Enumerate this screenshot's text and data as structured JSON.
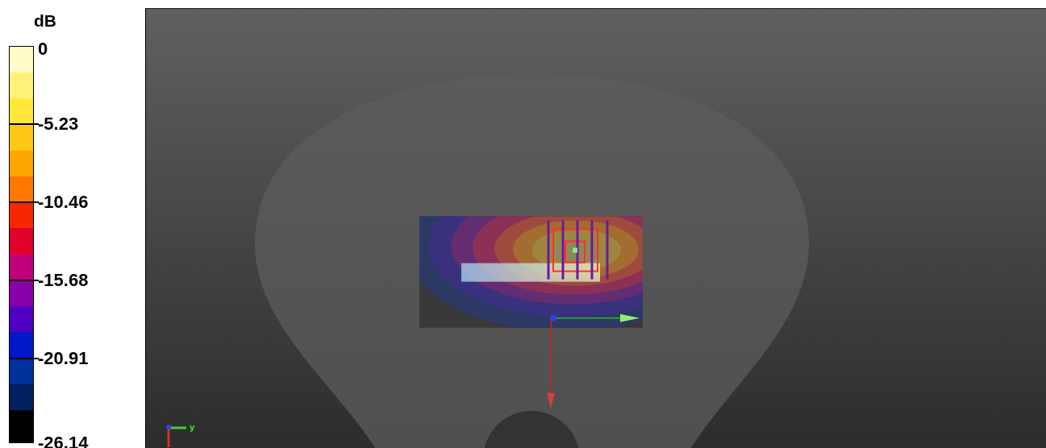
{
  "colorbar": {
    "unit": "dB",
    "swatches": [
      {
        "color": "#fffcc8"
      },
      {
        "color": "#fff27a"
      },
      {
        "color": "#ffe83a"
      },
      {
        "color": "#ffc815"
      },
      {
        "color": "#ffa500"
      },
      {
        "color": "#ff7800"
      },
      {
        "color": "#f52800"
      },
      {
        "color": "#e0002a"
      },
      {
        "color": "#c0007a"
      },
      {
        "color": "#8a00a8"
      },
      {
        "color": "#5000c0"
      },
      {
        "color": "#0018c8"
      },
      {
        "color": "#00309a"
      },
      {
        "color": "#002060"
      },
      {
        "color": "#000000"
      }
    ],
    "labels": [
      "0",
      "-5.23",
      "-10.46",
      "-15.68",
      "-20.91",
      "-26.14"
    ]
  },
  "viewport": {
    "axis_label": "y"
  }
}
